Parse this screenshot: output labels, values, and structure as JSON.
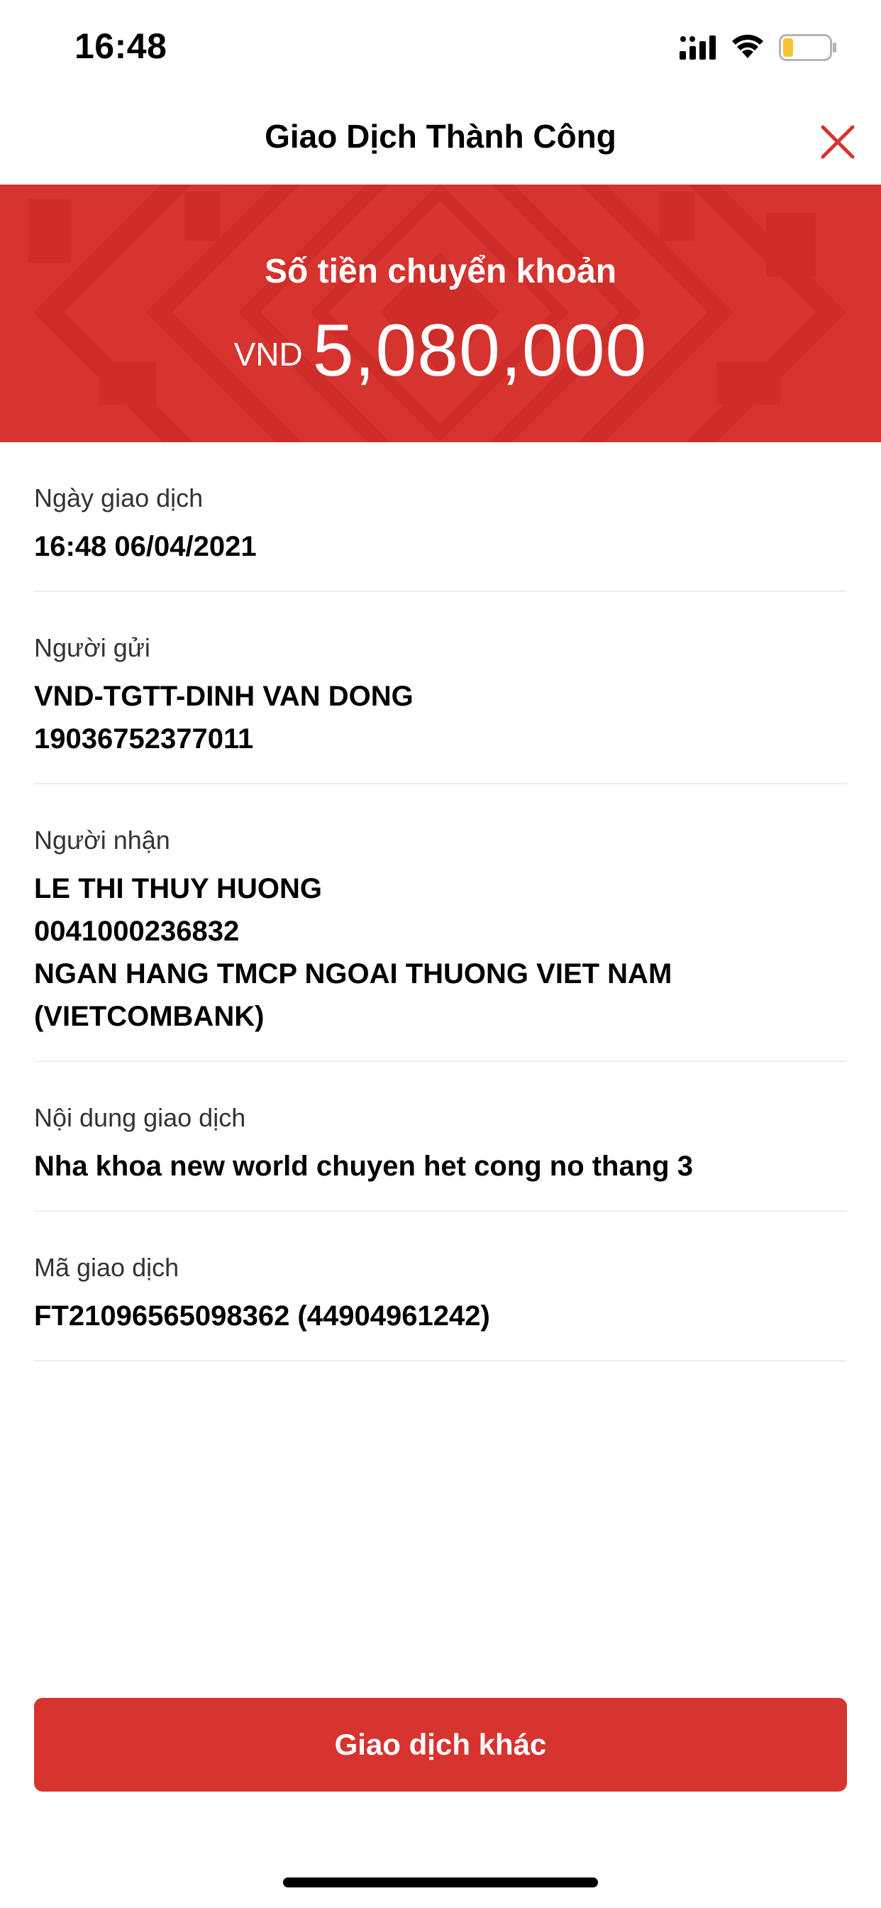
{
  "status_bar": {
    "time": "16:48",
    "icons": [
      "signal-icon",
      "wifi-icon",
      "battery-icon"
    ],
    "battery_color": "#f5c232"
  },
  "header": {
    "title": "Giao Dịch Thành Công",
    "close_icon": "close-icon",
    "close_color": "#d7332f"
  },
  "banner": {
    "label": "Số tiền chuyển khoản",
    "currency": "VND",
    "amount": "5,080,000",
    "background_color": "#d7332f"
  },
  "details": [
    {
      "label": "Ngày giao dịch",
      "values": [
        "16:48 06/04/2021"
      ]
    },
    {
      "label": "Người gửi",
      "values": [
        "VND-TGTT-DINH VAN DONG",
        "19036752377011"
      ]
    },
    {
      "label": "Người nhận",
      "values": [
        "LE THI THUY HUONG",
        "0041000236832",
        "NGAN HANG TMCP NGOAI THUONG VIET NAM",
        "(VIETCOMBANK)"
      ]
    },
    {
      "label": "Nội dung giao dịch",
      "values": [
        "Nha khoa new world chuyen het cong no thang 3"
      ]
    },
    {
      "label": "Mã giao dịch",
      "values": [
        "FT21096565098362 (44904961242)"
      ]
    }
  ],
  "action_button": {
    "label": "Giao dịch khác",
    "color": "#d7332f"
  }
}
